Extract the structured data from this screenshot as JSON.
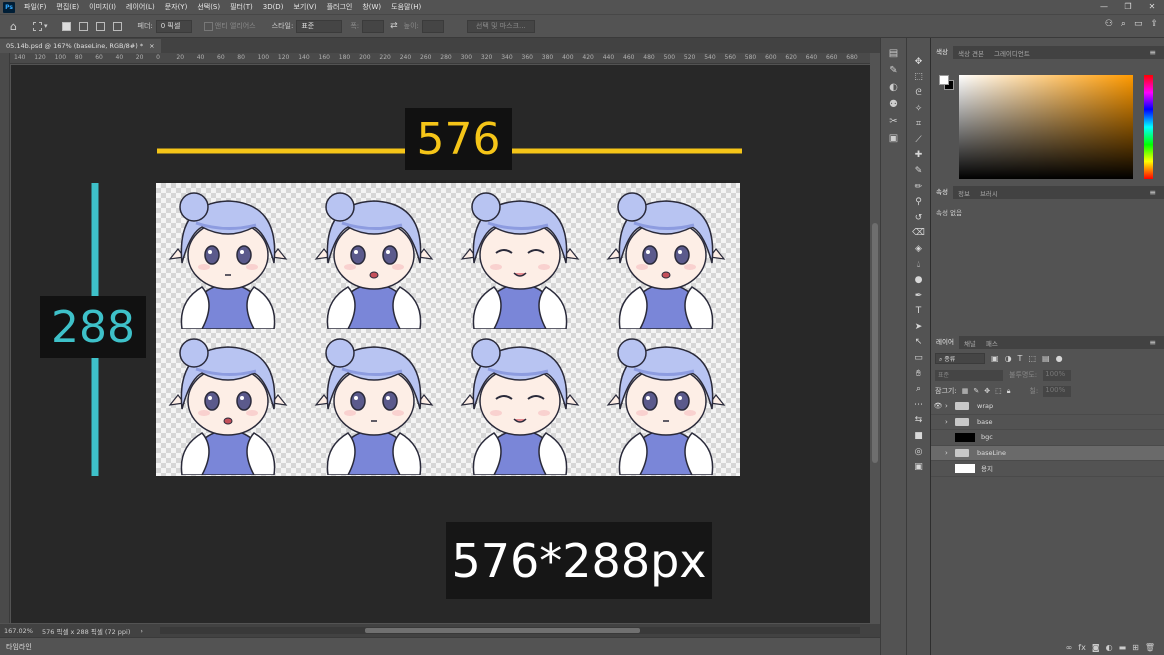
{
  "menu": {
    "items": [
      "파일(F)",
      "편집(E)",
      "이미지(I)",
      "레이어(L)",
      "문자(Y)",
      "선택(S)",
      "필터(T)",
      "3D(D)",
      "보기(V)",
      "플러그인",
      "창(W)",
      "도움말(H)"
    ]
  },
  "window": {
    "minimize": "—",
    "restore": "❐",
    "close": "✕"
  },
  "options": {
    "feather_label": "페더:",
    "feather_value": "0 픽셀",
    "antialias": "앤티 앨리어스",
    "style_label": "스타일:",
    "style_value": "표준",
    "width_label": "폭:",
    "height_label": "높이:",
    "select_mask": "선택 및 마스크..."
  },
  "document": {
    "tab_title": "05.14b.psd @ 167% (baseLine, RGB/8#) *",
    "close": "×"
  },
  "ruler": {
    "labels": [
      "140",
      "120",
      "100",
      "80",
      "60",
      "40",
      "20",
      "0",
      "20",
      "40",
      "60",
      "80",
      "100",
      "120",
      "140",
      "160",
      "180",
      "200",
      "220",
      "240",
      "260",
      "280",
      "300",
      "320",
      "340",
      "360",
      "380",
      "400",
      "420",
      "440",
      "460",
      "480",
      "500",
      "520",
      "540",
      "560",
      "580",
      "600",
      "620",
      "640",
      "660",
      "680"
    ]
  },
  "annotations": {
    "width_label": "576",
    "height_label": "288",
    "size_label": "576*288px",
    "width_color": "#f5c518",
    "height_color": "#3ec1c9"
  },
  "status": {
    "zoom": "167.02%",
    "doc_size": "576 픽셀 x 288 픽셀 (72 ppi)",
    "arrow": "›"
  },
  "timeline": {
    "label": "타임라인"
  },
  "color_panel": {
    "tabs": [
      "색상",
      "색상 견본",
      "그레이디언트"
    ]
  },
  "properties_panel": {
    "tabs": [
      "속성",
      "정보",
      "브러시"
    ],
    "content": "속성 없음"
  },
  "layers_panel": {
    "tabs": [
      "레이어",
      "채널",
      "패스"
    ],
    "kind_filter": "종류",
    "blend_mode": "표준",
    "opacity_label": "불투명도:",
    "opacity_value": "100%",
    "lock_label": "잠그기:",
    "fill_label": "칠:",
    "fill_value": "100%",
    "layers": [
      {
        "name": "wrap",
        "type": "folder",
        "visible": true
      },
      {
        "name": "base",
        "type": "folder",
        "visible": false
      },
      {
        "name": "bgc",
        "type": "layer",
        "visible": false,
        "thumb": "#000000"
      },
      {
        "name": "baseLine",
        "type": "folder",
        "visible": false,
        "selected": true
      },
      {
        "name": "용지",
        "type": "layer",
        "visible": false,
        "thumb": "#ffffff"
      }
    ]
  },
  "sprite": {
    "hair_color": "#b8c4f2",
    "hair_shadow": "#8d9ce0",
    "skin": "#fdeee6",
    "outline": "#2a2a3a",
    "eye": "#5b5a8c",
    "coat": "#7a86d8",
    "fur": "#ffffff"
  }
}
